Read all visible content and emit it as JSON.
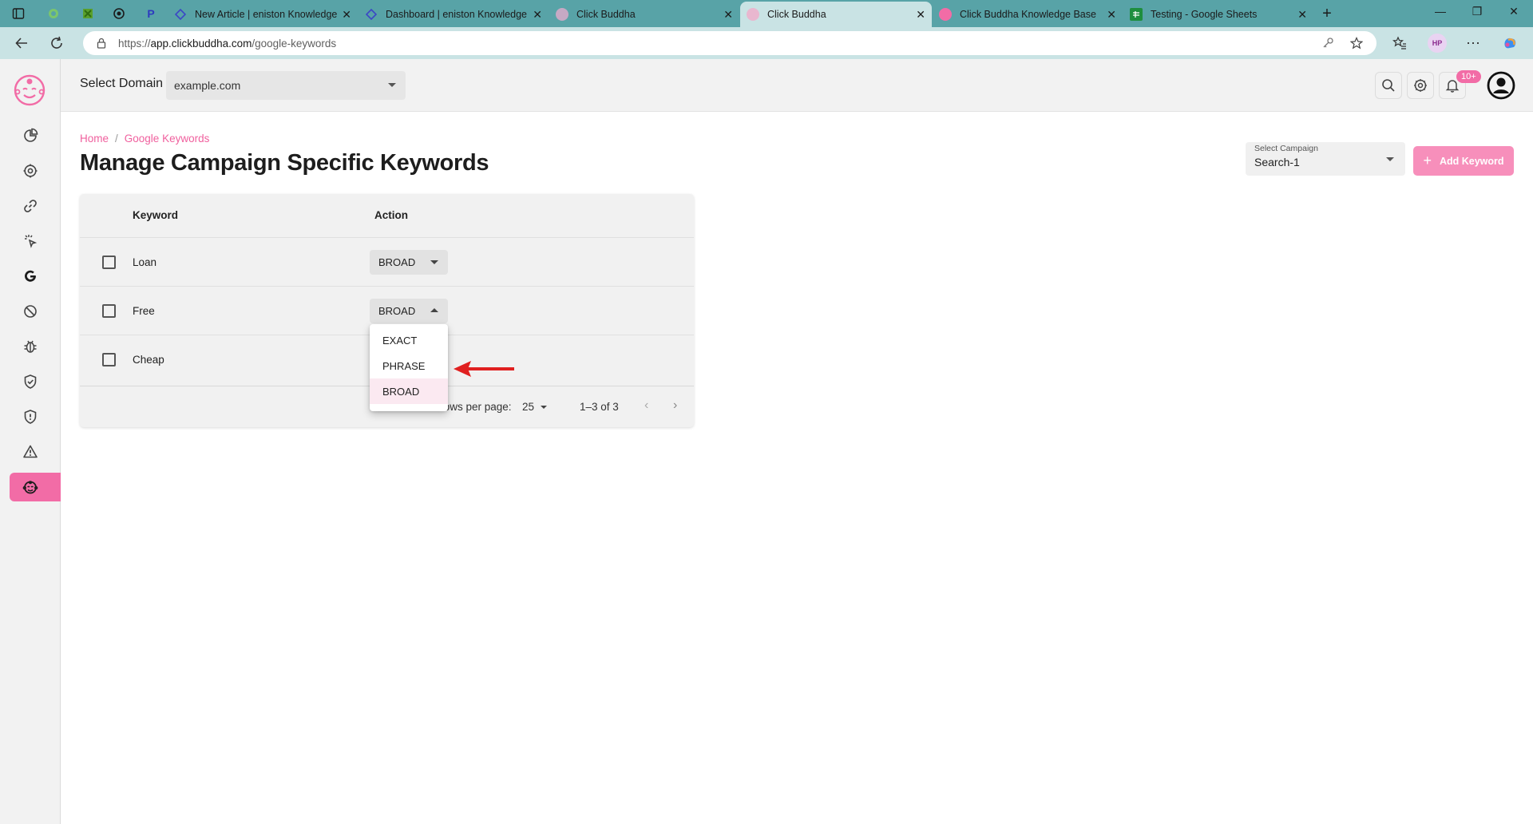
{
  "browser": {
    "tabs": [
      {
        "title": "New Article | eniston Knowledge E"
      },
      {
        "title": "Dashboard | eniston Knowledge E"
      },
      {
        "title": "Click Buddha"
      },
      {
        "title": "Click Buddha"
      },
      {
        "title": "Click Buddha Knowledge Base"
      },
      {
        "title": "Testing - Google Sheets"
      }
    ],
    "url_prefix": "https://",
    "url_host": "app.clickbuddha.com",
    "url_path": "/google-keywords",
    "profile_initials": "HP"
  },
  "appbar": {
    "select_domain_label": "Select Domain",
    "domain_value": "example.com",
    "notification_badge": "10+"
  },
  "sidebar": {
    "items": [
      "dashboard-icon",
      "settings-icon",
      "link-icon",
      "click-icon",
      "google-icon",
      "block-icon",
      "bug-icon",
      "shield-check-icon",
      "shield-icon",
      "warning-icon",
      "buddha-icon"
    ],
    "active_index": 10
  },
  "page": {
    "breadcrumb_home": "Home",
    "breadcrumb_separator": "/",
    "breadcrumb_current": "Google Keywords",
    "title": "Manage Campaign Specific Keywords",
    "campaign_label": "Select Campaign",
    "campaign_value": "Search-1",
    "add_keyword_label": "Add Keyword"
  },
  "table": {
    "col_keyword": "Keyword",
    "col_action": "Action",
    "rows": [
      {
        "keyword": "Loan",
        "match": "BROAD"
      },
      {
        "keyword": "Free",
        "match": "BROAD"
      },
      {
        "keyword": "Cheap",
        "match": "BROAD"
      }
    ],
    "rows_per_page_label": "Rows per page:",
    "rows_per_page_value": "25",
    "range": "1–3 of 3"
  },
  "match_menu": {
    "options": [
      "EXACT",
      "PHRASE",
      "BROAD"
    ],
    "selected": "BROAD"
  },
  "colors": {
    "accent": "#f26ca6",
    "add_button": "#f78fbb",
    "tabbar": "#58a3a7",
    "annotation_arrow": "#e02020"
  }
}
